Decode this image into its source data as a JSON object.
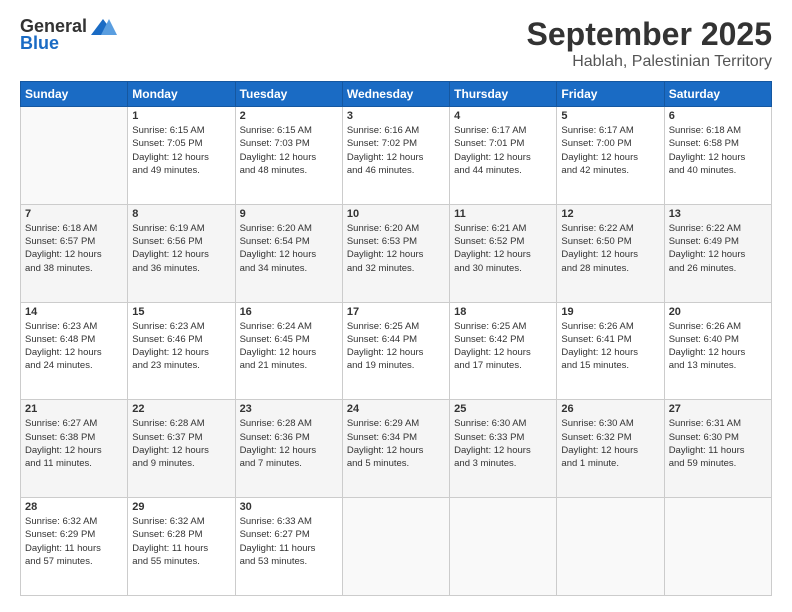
{
  "logo": {
    "general": "General",
    "blue": "Blue"
  },
  "header": {
    "month": "September 2025",
    "location": "Hablah, Palestinian Territory"
  },
  "weekdays": [
    "Sunday",
    "Monday",
    "Tuesday",
    "Wednesday",
    "Thursday",
    "Friday",
    "Saturday"
  ],
  "weeks": [
    [
      {
        "day": "",
        "info": ""
      },
      {
        "day": "1",
        "info": "Sunrise: 6:15 AM\nSunset: 7:05 PM\nDaylight: 12 hours\nand 49 minutes."
      },
      {
        "day": "2",
        "info": "Sunrise: 6:15 AM\nSunset: 7:03 PM\nDaylight: 12 hours\nand 48 minutes."
      },
      {
        "day": "3",
        "info": "Sunrise: 6:16 AM\nSunset: 7:02 PM\nDaylight: 12 hours\nand 46 minutes."
      },
      {
        "day": "4",
        "info": "Sunrise: 6:17 AM\nSunset: 7:01 PM\nDaylight: 12 hours\nand 44 minutes."
      },
      {
        "day": "5",
        "info": "Sunrise: 6:17 AM\nSunset: 7:00 PM\nDaylight: 12 hours\nand 42 minutes."
      },
      {
        "day": "6",
        "info": "Sunrise: 6:18 AM\nSunset: 6:58 PM\nDaylight: 12 hours\nand 40 minutes."
      }
    ],
    [
      {
        "day": "7",
        "info": "Sunrise: 6:18 AM\nSunset: 6:57 PM\nDaylight: 12 hours\nand 38 minutes."
      },
      {
        "day": "8",
        "info": "Sunrise: 6:19 AM\nSunset: 6:56 PM\nDaylight: 12 hours\nand 36 minutes."
      },
      {
        "day": "9",
        "info": "Sunrise: 6:20 AM\nSunset: 6:54 PM\nDaylight: 12 hours\nand 34 minutes."
      },
      {
        "day": "10",
        "info": "Sunrise: 6:20 AM\nSunset: 6:53 PM\nDaylight: 12 hours\nand 32 minutes."
      },
      {
        "day": "11",
        "info": "Sunrise: 6:21 AM\nSunset: 6:52 PM\nDaylight: 12 hours\nand 30 minutes."
      },
      {
        "day": "12",
        "info": "Sunrise: 6:22 AM\nSunset: 6:50 PM\nDaylight: 12 hours\nand 28 minutes."
      },
      {
        "day": "13",
        "info": "Sunrise: 6:22 AM\nSunset: 6:49 PM\nDaylight: 12 hours\nand 26 minutes."
      }
    ],
    [
      {
        "day": "14",
        "info": "Sunrise: 6:23 AM\nSunset: 6:48 PM\nDaylight: 12 hours\nand 24 minutes."
      },
      {
        "day": "15",
        "info": "Sunrise: 6:23 AM\nSunset: 6:46 PM\nDaylight: 12 hours\nand 23 minutes."
      },
      {
        "day": "16",
        "info": "Sunrise: 6:24 AM\nSunset: 6:45 PM\nDaylight: 12 hours\nand 21 minutes."
      },
      {
        "day": "17",
        "info": "Sunrise: 6:25 AM\nSunset: 6:44 PM\nDaylight: 12 hours\nand 19 minutes."
      },
      {
        "day": "18",
        "info": "Sunrise: 6:25 AM\nSunset: 6:42 PM\nDaylight: 12 hours\nand 17 minutes."
      },
      {
        "day": "19",
        "info": "Sunrise: 6:26 AM\nSunset: 6:41 PM\nDaylight: 12 hours\nand 15 minutes."
      },
      {
        "day": "20",
        "info": "Sunrise: 6:26 AM\nSunset: 6:40 PM\nDaylight: 12 hours\nand 13 minutes."
      }
    ],
    [
      {
        "day": "21",
        "info": "Sunrise: 6:27 AM\nSunset: 6:38 PM\nDaylight: 12 hours\nand 11 minutes."
      },
      {
        "day": "22",
        "info": "Sunrise: 6:28 AM\nSunset: 6:37 PM\nDaylight: 12 hours\nand 9 minutes."
      },
      {
        "day": "23",
        "info": "Sunrise: 6:28 AM\nSunset: 6:36 PM\nDaylight: 12 hours\nand 7 minutes."
      },
      {
        "day": "24",
        "info": "Sunrise: 6:29 AM\nSunset: 6:34 PM\nDaylight: 12 hours\nand 5 minutes."
      },
      {
        "day": "25",
        "info": "Sunrise: 6:30 AM\nSunset: 6:33 PM\nDaylight: 12 hours\nand 3 minutes."
      },
      {
        "day": "26",
        "info": "Sunrise: 6:30 AM\nSunset: 6:32 PM\nDaylight: 12 hours\nand 1 minute."
      },
      {
        "day": "27",
        "info": "Sunrise: 6:31 AM\nSunset: 6:30 PM\nDaylight: 11 hours\nand 59 minutes."
      }
    ],
    [
      {
        "day": "28",
        "info": "Sunrise: 6:32 AM\nSunset: 6:29 PM\nDaylight: 11 hours\nand 57 minutes."
      },
      {
        "day": "29",
        "info": "Sunrise: 6:32 AM\nSunset: 6:28 PM\nDaylight: 11 hours\nand 55 minutes."
      },
      {
        "day": "30",
        "info": "Sunrise: 6:33 AM\nSunset: 6:27 PM\nDaylight: 11 hours\nand 53 minutes."
      },
      {
        "day": "",
        "info": ""
      },
      {
        "day": "",
        "info": ""
      },
      {
        "day": "",
        "info": ""
      },
      {
        "day": "",
        "info": ""
      }
    ]
  ]
}
